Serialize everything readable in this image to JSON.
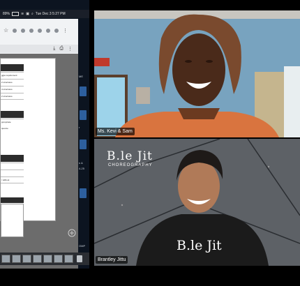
{
  "menubar": {
    "battery": "89%",
    "datetime": "Tue Dec 3  5:27 PM"
  },
  "doc_rows": [
    "ggie requirement",
    "2 structures",
    "4 structures",
    "2 structures",
    "ppropriate",
    "quence",
    "r without"
  ],
  "side_labels": [
    "ME",
    "r",
    "s &",
    "4-25",
    "OMP"
  ],
  "participants": [
    {
      "name": "Ms. Kevi & Sam"
    },
    {
      "name": "Brantley Jittu"
    }
  ],
  "brand": {
    "name": "B.le Jit",
    "sub": "CHOREOGRAPHY"
  },
  "shirt_text": "B.le Jit",
  "colors": {
    "background": "#000000",
    "wall_blue": "#7aa6c2",
    "shirt_orange": "#d9743f",
    "wall_gray": "#5d6166"
  }
}
